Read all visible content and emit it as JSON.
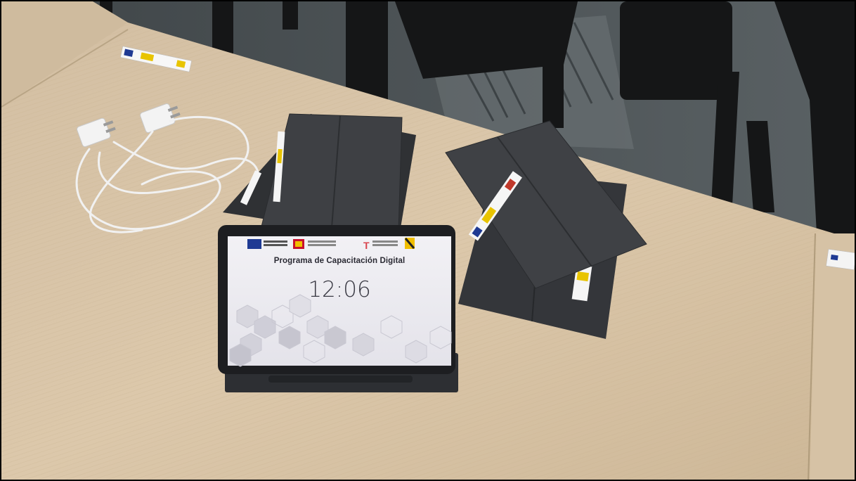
{
  "scene": {
    "description_tags": [
      "desk",
      "chargers",
      "tablets",
      "chairs"
    ]
  },
  "tablet_screen": {
    "title": "Programa de Capacitación Digital",
    "time": "12:06",
    "date": "",
    "logos": [
      "eu-funded-logo",
      "spain-government-logo",
      "recovery-plan-logo",
      "region-coat-of-arms-logo"
    ]
  },
  "colors": {
    "desk": "#d8c3a5",
    "tablet_case": "#3c3e42",
    "screen_bg": "#ecebf0",
    "floor": "#4c5356"
  }
}
